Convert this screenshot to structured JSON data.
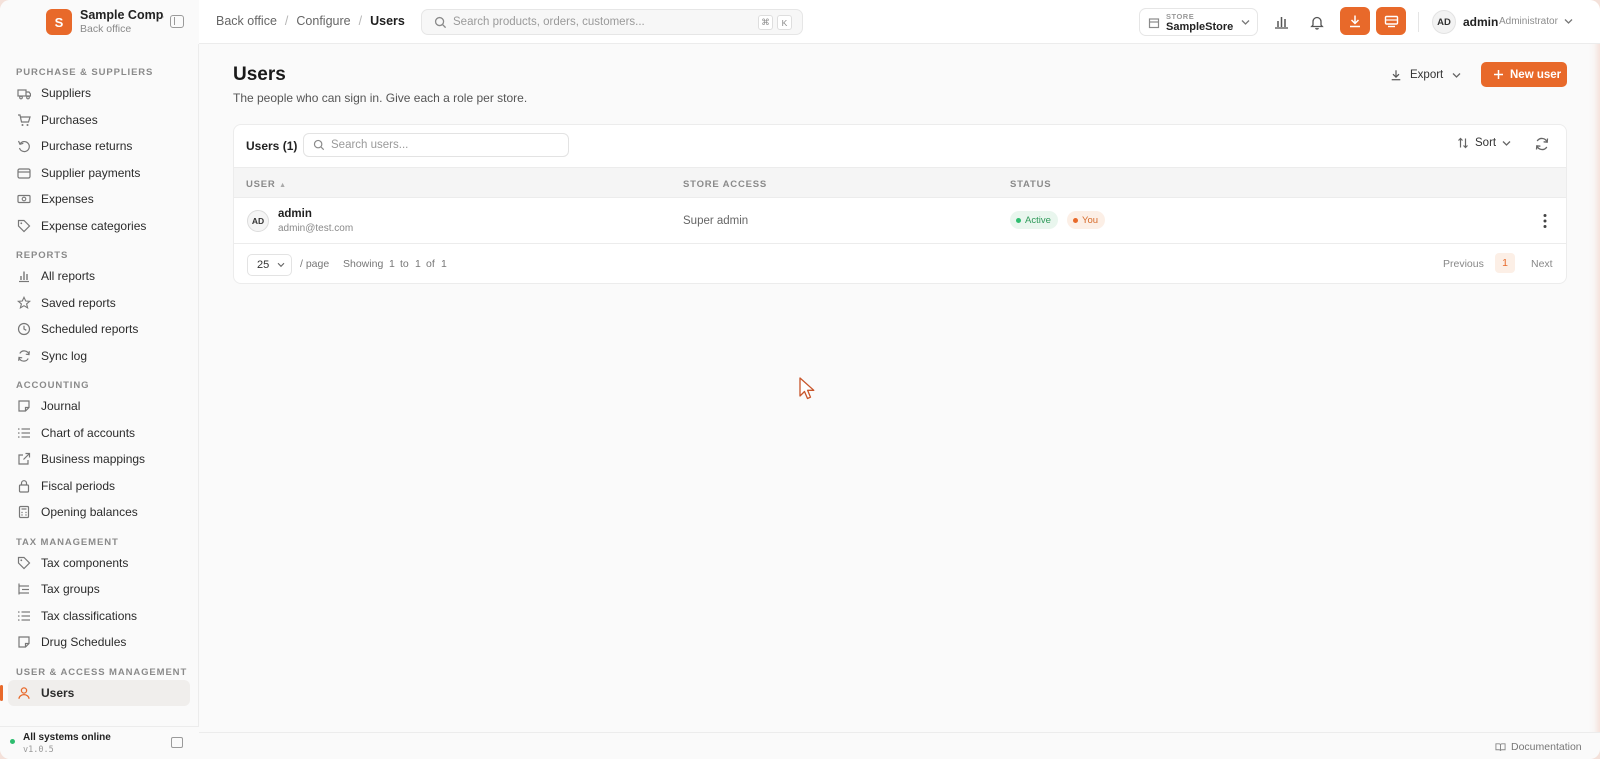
{
  "brand": {
    "logo_letter": "S",
    "name": "Sample Company",
    "subtitle": "Back office",
    "accent": "#e8692a"
  },
  "sidebar": {
    "groups": [
      {
        "title": "Purchase & Suppliers",
        "items": [
          {
            "label": "Suppliers",
            "icon": "truck-icon"
          },
          {
            "label": "Purchases",
            "icon": "cart-icon"
          },
          {
            "label": "Purchase returns",
            "icon": "return-icon"
          },
          {
            "label": "Supplier payments",
            "icon": "wallet-icon"
          },
          {
            "label": "Expenses",
            "icon": "banknote-icon"
          },
          {
            "label": "Expense categories",
            "icon": "tag-icon"
          }
        ]
      },
      {
        "title": "Reports",
        "items": [
          {
            "label": "All reports",
            "icon": "chart-icon"
          },
          {
            "label": "Saved reports",
            "icon": "star-icon"
          },
          {
            "label": "Scheduled reports",
            "icon": "clock-icon"
          },
          {
            "label": "Sync log",
            "icon": "refresh-icon"
          }
        ]
      },
      {
        "title": "Accounting",
        "items": [
          {
            "label": "Journal",
            "icon": "note-icon"
          },
          {
            "label": "Chart of accounts",
            "icon": "list-icon"
          },
          {
            "label": "Business mappings",
            "icon": "external-link-icon"
          },
          {
            "label": "Fiscal periods",
            "icon": "lock-icon"
          },
          {
            "label": "Opening balances",
            "icon": "calculator-icon"
          }
        ]
      },
      {
        "title": "Tax management",
        "items": [
          {
            "label": "Tax components",
            "icon": "tag-icon"
          },
          {
            "label": "Tax groups",
            "icon": "tree-icon"
          },
          {
            "label": "Tax classifications",
            "icon": "list-icon"
          },
          {
            "label": "Drug Schedules",
            "icon": "note-icon"
          }
        ]
      },
      {
        "title": "User & Access Management",
        "items": [
          {
            "label": "Users",
            "icon": "user-icon",
            "active": true
          }
        ]
      }
    ],
    "footer": {
      "status": "All systems online",
      "version": "v1.0.5",
      "status_color": "#2ebd6f"
    }
  },
  "topbar": {
    "breadcrumbs": [
      "Back office",
      "Configure",
      "Users"
    ],
    "search_placeholder": "Search products, orders, customers...",
    "shortcut_keys": [
      "⌘",
      "K"
    ],
    "store_label": "STORE",
    "store_name": "SampleStore",
    "user_initials": "AD",
    "user_name": "admin",
    "user_role": "Administrator"
  },
  "page": {
    "title": "Users",
    "subtitle": "The people who can sign in. Give each a role per store.",
    "export_label": "Export",
    "new_label": "New user"
  },
  "table": {
    "title": "Users (1)",
    "search_placeholder": "Search users...",
    "sort_label": "Sort",
    "columns": [
      "USER",
      "STORE ACCESS",
      "STATUS"
    ],
    "rows": [
      {
        "initials": "AD",
        "name": "admin",
        "email": "admin@test.com",
        "access": "Super admin",
        "status": "Active",
        "tag": "You"
      }
    ],
    "pager": {
      "page_size": "25",
      "per_page": "/ page",
      "showing": "Showing",
      "from": "1",
      "to_word": "to",
      "to": "1",
      "of_word": "of",
      "total": "1",
      "previous": "Previous",
      "current": "1",
      "next": "Next"
    }
  },
  "footer": {
    "documentation": "Documentation"
  }
}
